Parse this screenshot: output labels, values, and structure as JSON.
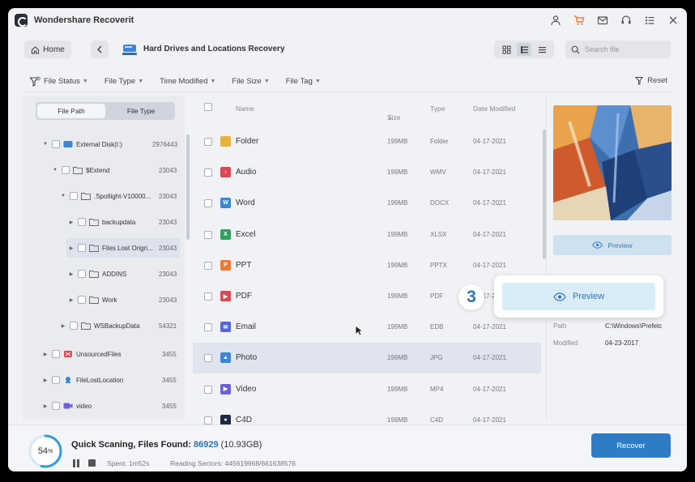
{
  "window": {
    "title": "Wondershare Recoverit"
  },
  "title_icons": [
    "user-icon",
    "cart-icon",
    "mail-icon",
    "headset-icon",
    "menu-icon",
    "close-icon"
  ],
  "nav": {
    "home_label": "Home",
    "page_title": "Hard Drives and Locations Recovery",
    "search_placeholder": "Search file"
  },
  "filters": {
    "items": [
      "File Status",
      "File Type",
      "Time Modified",
      "File Size",
      "File Tag"
    ],
    "reset_label": "Reset"
  },
  "tree": {
    "tabs": [
      "File Path",
      "File Type"
    ],
    "active_tab": "File Path",
    "rows": [
      {
        "label": "External Disk(I:)",
        "count": "2976443"
      },
      {
        "label": "$Extend",
        "count": "23043"
      },
      {
        "label": ".Spotlight-V10000...",
        "count": "23043"
      },
      {
        "label": "backupdata",
        "count": "23043"
      },
      {
        "label": "Files Lost Origri...",
        "count": "23043"
      },
      {
        "label": "ADDINS",
        "count": "23043"
      },
      {
        "label": "Work",
        "count": "23043"
      },
      {
        "label": "WSBackupData",
        "count": "54321"
      },
      {
        "label": "UnsourcedFiles",
        "count": "3455"
      },
      {
        "label": "FileLostLocation",
        "count": "3455"
      },
      {
        "label": "video",
        "count": "3455"
      }
    ]
  },
  "list": {
    "columns": {
      "name": "Name",
      "size": "Size",
      "type": "Type",
      "date": "Date Modified"
    },
    "rows": [
      {
        "name": "Folder",
        "size": "199MB",
        "type": "Folder",
        "date": "04-17-2021",
        "color": "#e8b23a",
        "glyph": ""
      },
      {
        "name": "Audio",
        "size": "199MB",
        "type": "WMV",
        "date": "04-17-2021",
        "color": "#e0464f",
        "glyph": "♪"
      },
      {
        "name": "Word",
        "size": "199MB",
        "type": "DOCX",
        "date": "04-17-2021",
        "color": "#3a86d8",
        "glyph": "W"
      },
      {
        "name": "Excel",
        "size": "199MB",
        "type": "XLSX",
        "date": "04-17-2021",
        "color": "#2fa25a",
        "glyph": "X"
      },
      {
        "name": "PPT",
        "size": "199MB",
        "type": "PPTX",
        "date": "04-17-2021",
        "color": "#ee7a2f",
        "glyph": "P"
      },
      {
        "name": "PDF",
        "size": "199MB",
        "type": "PDF",
        "date": "04-17-2021",
        "color": "#e0464f",
        "glyph": "▶"
      },
      {
        "name": "Email",
        "size": "199MB",
        "type": "EDB",
        "date": "04-17-2021",
        "color": "#5468d8",
        "glyph": "✉"
      },
      {
        "name": "Photo",
        "size": "199MB",
        "type": "JPG",
        "date": "04-17-2021",
        "color": "#3a86d8",
        "glyph": "▲"
      },
      {
        "name": "Video",
        "size": "199MB",
        "type": "MP4",
        "date": "04-17-2021",
        "color": "#6b5fe0",
        "glyph": "▶"
      },
      {
        "name": "C4D",
        "size": "199MB",
        "type": "C4D",
        "date": "04-17-2021",
        "color": "#1d2a44",
        "glyph": "●"
      }
    ]
  },
  "preview": {
    "button_label": "Preview",
    "path_label": "Path",
    "path_value": "C:\\Windows\\Prefetc",
    "modified_label": "Modified",
    "modified_value": "04-23-2017"
  },
  "callout": {
    "step": "3",
    "button_label": "Preview"
  },
  "status": {
    "progress_percent": 54,
    "progress_unit": "%",
    "scan_label": "Quick Scaning, Files Found: ",
    "files_found": "86929",
    "files_size": "(10.93GB)",
    "spent": "Spent: 1m52s",
    "sectors": "Reading Sectors: 445619968/661638576",
    "recover_label": "Recover"
  },
  "colors": {
    "accent": "#2f7cc5",
    "selected_row": "#dfe4ee",
    "callout_button": "#d9ecf8"
  }
}
